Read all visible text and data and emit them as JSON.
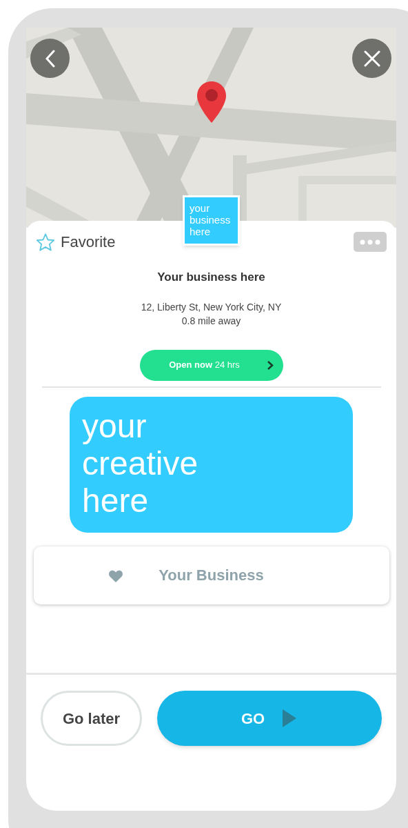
{
  "favorite": {
    "label": "Favorite",
    "checked": false
  },
  "logo": "your business here",
  "title": "Your business here",
  "address": "12, Liberty St, New York City, NY",
  "distance": "0.8 mile away",
  "hours": "**Open now** 24 hrs",
  "creative": "your creative here",
  "business_button": "Your Business",
  "actions": [
    {
      "label": "Go later",
      "kind": "secondary"
    },
    {
      "label": "GO",
      "kind": "primary"
    }
  ]
}
